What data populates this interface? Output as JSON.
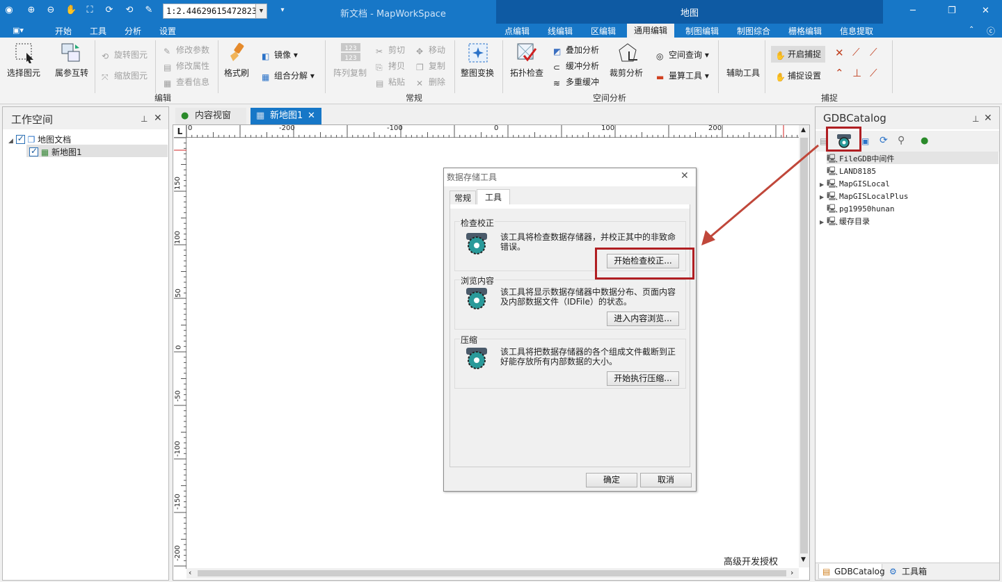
{
  "app": {
    "doc_title": "新文档 - MapWorkSpace",
    "context_title": "地图",
    "scale_value": "1:2.44629615472823"
  },
  "menu_tabs": [
    "开始",
    "工具",
    "分析",
    "设置"
  ],
  "context_tabs": [
    "点编辑",
    "线编辑",
    "区编辑",
    "通用编辑",
    "制图编辑",
    "制图综合",
    "栅格编辑",
    "信息提取"
  ],
  "ribbon": {
    "edit": {
      "select": "选择图元",
      "attr_swap": "属参互转",
      "rotate": "旋转图元",
      "scale": "缩放图元",
      "modify_param": "修改参数",
      "modify_attr": "修改属性",
      "view_info": "查看信息",
      "format_brush": "格式刷",
      "mirror": "镜像",
      "group_split": "组合分解",
      "group_label": "编辑"
    },
    "common": {
      "array_copy": "阵列复制",
      "cut": "剪切",
      "copy_tool": "拷贝",
      "paste": "粘贴",
      "move": "移动",
      "duplicate": "复制",
      "delete": "删除",
      "transform": "整图变换",
      "group_label": "常规"
    },
    "spatial": {
      "topo_check": "拓扑检查",
      "overlay": "叠加分析",
      "buffer": "缓冲分析",
      "multi_buffer": "多重缓冲",
      "clip": "裁剪分析",
      "space_query": "空间查询",
      "measure": "量算工具",
      "group_label": "空间分析"
    },
    "assist": {
      "tools": "辅助工具"
    },
    "snap": {
      "enable": "开启捕捉",
      "settings": "捕捉设置",
      "group_label": "捕捉"
    }
  },
  "workspace": {
    "title": "工作空间",
    "tree": [
      {
        "label": "地图文档",
        "checked": true
      },
      {
        "label": "新地图1",
        "checked": true
      }
    ]
  },
  "doc_tabs": [
    "内容视窗",
    "新地图1"
  ],
  "ruler": {
    "h_ticks": [
      "0",
      "-200",
      "-100",
      "0",
      "100",
      "200"
    ],
    "v_ticks": [
      "150",
      "100",
      "50",
      "0",
      "-50",
      "-100",
      "-150",
      "-200"
    ]
  },
  "canvas": {
    "watermark": "高级开发授权"
  },
  "dialog": {
    "title": "数据存储工具",
    "tabs": [
      "常规",
      "工具"
    ],
    "sections": [
      {
        "title": "检查校正",
        "desc": "该工具将检查数据存储器，并校正其中的非致命错误。",
        "button": "开始检查校正..."
      },
      {
        "title": "浏览内容",
        "desc": "该工具将显示数据存储器中数据分布、页面内容及内部数据文件（IDFile）的状态。",
        "button": "进入内容浏览..."
      },
      {
        "title": "压缩",
        "desc": "该工具将把数据存储器的各个组成文件截断到正好能存放所有内部数据的大小。",
        "button": "开始执行压缩..."
      }
    ],
    "ok": "确定",
    "cancel": "取消"
  },
  "gdb": {
    "title": "GDBCatalog",
    "items": [
      {
        "label": "FileGDB中间件",
        "expandable": false
      },
      {
        "label": "LAND8185",
        "expandable": false
      },
      {
        "label": "MapGISLocal",
        "expandable": true
      },
      {
        "label": "MapGISLocalPlus",
        "expandable": true
      },
      {
        "label": "pg19950hunan",
        "expandable": false
      },
      {
        "label": "缓存目录",
        "expandable": true
      }
    ],
    "bottom_tabs": [
      "GDBCatalog",
      "工具箱"
    ]
  },
  "colors": {
    "titlebar": "#1777c7",
    "context_bar": "#0e5aa3",
    "highlight_red": "#b01e22",
    "arrow": "#c0473a"
  }
}
